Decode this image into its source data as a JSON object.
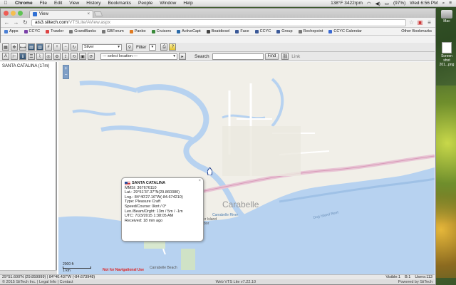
{
  "menubar": {
    "apple": "",
    "items": [
      "Chrome",
      "File",
      "Edit",
      "View",
      "History",
      "Bookmarks",
      "People",
      "Window",
      "Help"
    ],
    "status": {
      "temp": "138°F 3422rpm",
      "battery": "(97%)",
      "clock": "Wed 6:56 PM"
    }
  },
  "browser": {
    "tab_title": "View",
    "url_domain": "ais3.siitech.com",
    "url_path": "/VTSLite/AView.aspx",
    "bookmarks": [
      {
        "label": "Apps",
        "color": "#4a7fd4"
      },
      {
        "label": "CCYC",
        "color": "#7a3fa8"
      },
      {
        "label": "Trawler",
        "color": "#d44"
      },
      {
        "label": "GrandBanks",
        "color": "#777"
      },
      {
        "label": "GBForum",
        "color": "#777"
      },
      {
        "label": "Panbo",
        "color": "#e07a20"
      },
      {
        "label": "Cruisers",
        "color": "#3a8a3a"
      },
      {
        "label": "ActiveCapt",
        "color": "#2a6aa8"
      },
      {
        "label": "Boatdiesel",
        "color": "#444"
      },
      {
        "label": "Face",
        "color": "#3b5998"
      },
      {
        "label": "CCYC",
        "color": "#3b5998"
      },
      {
        "label": "Group",
        "color": "#3b5998"
      },
      {
        "label": "Rochepoint",
        "color": "#777"
      },
      {
        "label": "CCYC Calendar",
        "color": "#3a6ad4"
      }
    ],
    "other_bookmarks": "Other Bookmarks"
  },
  "toolbar": {
    "theme_select": "Silver",
    "filter_label": "Filter",
    "location_select": "--- select location ---",
    "search_label": "Search",
    "find_label": "Find",
    "link_label": "Link"
  },
  "sidebar": {
    "vessel_entry": "SANTA CATALINA (17m)"
  },
  "map": {
    "zoom_in": "+",
    "zoom_out": "−",
    "town_label": "Carabelle",
    "river_label": "Carrabelle River",
    "beach_label": "Carrabelle Beach",
    "island_label": "Timber Island",
    "island_sub": "Harbor",
    "sea_label": "Dog Island Reef",
    "scale_label": "2000 ft",
    "scale_label_m": "1 km",
    "nav_warning": "Not for Navigational Use"
  },
  "popup": {
    "name": "SANTA CATALINA",
    "lines": [
      "MMSI: 367676110",
      "Lat.: 29°51'37.37\"N(29.860380)",
      "Lng.: 84°40'27.16\"W(-84.674210)",
      "Type: Pleasure Craft",
      "Speed/Course: 0knt / 0°",
      "Len./Beam/Drght: 13m / 5m / -1m",
      "UTC: 7/23/2015 1:38:05 AM",
      "Received: 18 min ago"
    ]
  },
  "statusbar": {
    "coords": "29°51.600'N (29.859999) | 84°40.437'W (-84.673948)",
    "visible": "Visible:1",
    "b": "B:1",
    "users": "Users:113"
  },
  "footer": {
    "left": "© 2015 SiiTech Inc. | Legal Info | Contact",
    "version": "Web VTS Lite v7.22.10",
    "powered": "Powered by SiiTech"
  },
  "desktop": {
    "hd_label": "Mac",
    "file_label": "Screen shot 201...png"
  }
}
